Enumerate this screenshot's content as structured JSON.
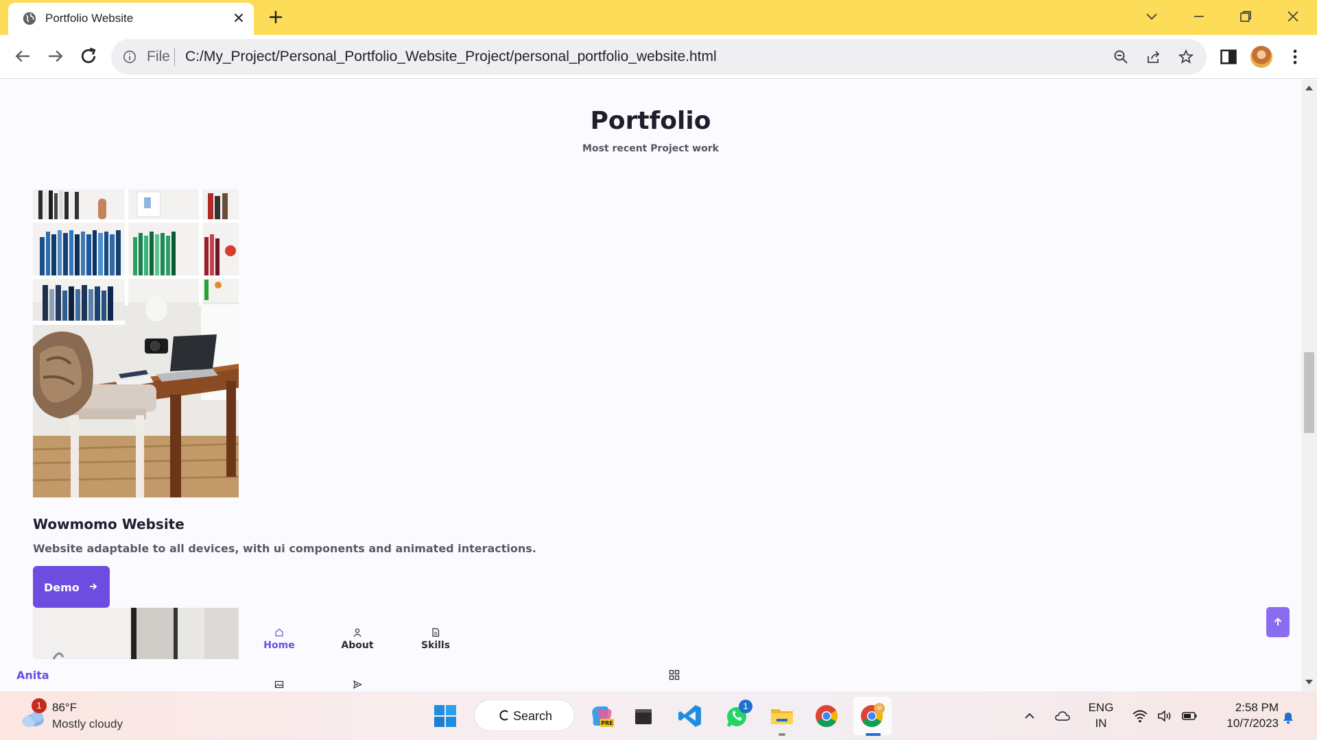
{
  "browser": {
    "tab_title": "Portfolio Website",
    "url_scheme": "File",
    "url": "C:/My_Project/Personal_Portfolio_Website_Project/personal_portfolio_website.html"
  },
  "page": {
    "title": "Portfolio",
    "subtitle": "Most recent Project work",
    "project": {
      "title": "Wowmomo Website",
      "description": "Website adaptable to all devices, with ui components and animated interactions.",
      "button_label": "Demo"
    },
    "nav": {
      "items": [
        "Home",
        "About",
        "Skills"
      ],
      "active": "Home"
    },
    "brand": "Anita"
  },
  "taskbar": {
    "weather_badge": "1",
    "weather_temp": "86°F",
    "weather_desc": "Mostly cloudy",
    "search_label": "Search",
    "whatsapp_badge": "1",
    "lang_top": "ENG",
    "lang_bottom": "IN",
    "time": "2:58 PM",
    "date": "10/7/2023"
  },
  "colors": {
    "tabbar": "#fcdc58",
    "accent": "#6c4de0",
    "page_bg": "#fbfafe"
  }
}
